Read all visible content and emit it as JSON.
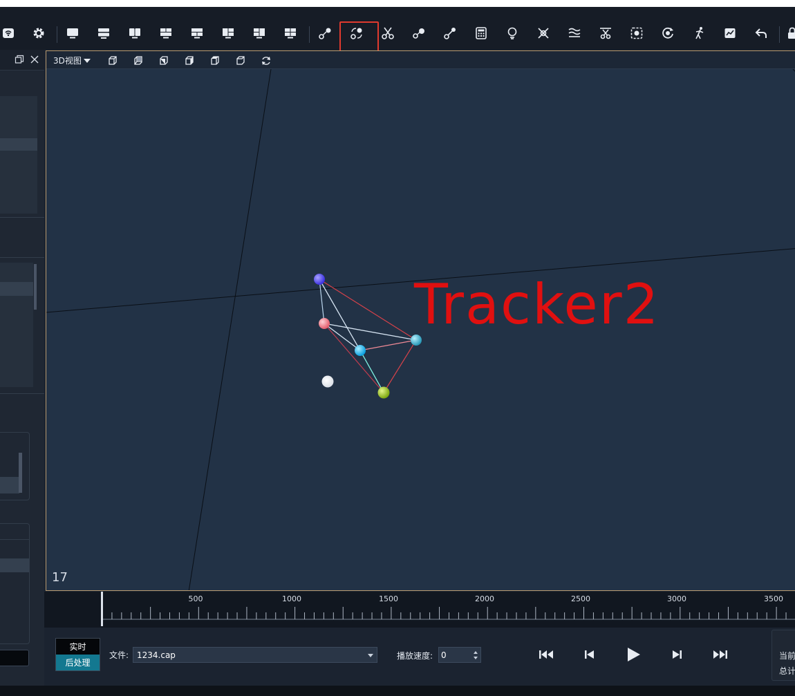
{
  "colors": {
    "accent_highlight": "#e03a2e",
    "viewport_bg": "#223246",
    "viewport_border": "#b99a6e",
    "overlay_text": "#e01010",
    "post_mode_bg": "#137890"
  },
  "toolbar": {
    "icons": [
      "wifi-settings-icon",
      "gear-icon",
      "layout-single-icon",
      "layout-split-horizontal-icon",
      "layout-split-vertical-icon",
      "layout-grid-icon",
      "layout-top-split-icon",
      "layout-right-split-icon",
      "layout-left-split-icon",
      "layout-quad-icon",
      "marker-link-icon",
      "marker-rename-icon",
      "cut-icon",
      "marker-add-icon",
      "marker-connect-icon",
      "calculator-icon",
      "bulb-icon",
      "delete-marker-icon",
      "smooth-wave-icon",
      "trim-icon",
      "target-frame-icon",
      "rotate-target-icon",
      "skeleton-icon",
      "chart-icon",
      "undo-icon",
      "lock-icon"
    ],
    "highlighted_icon": "marker-rename-icon"
  },
  "left_panel": {
    "restore_icon": "restore-window-icon",
    "close_icon": "close-icon"
  },
  "viewport": {
    "view_mode": "3D视图",
    "view_icons": [
      "view-front-icon",
      "view-back-icon",
      "view-left-icon",
      "view-right-icon",
      "view-top-icon",
      "view-bottom-icon",
      "view-reset-icon"
    ],
    "frame_number": "17",
    "overlay_label": "Tracker2",
    "markers": [
      {
        "name": "marker-blue",
        "color": "#4a3ff0"
      },
      {
        "name": "marker-pink",
        "color": "#f07a86"
      },
      {
        "name": "marker-cyan-center",
        "color": "#16b8f0"
      },
      {
        "name": "marker-teal",
        "color": "#3ab0c8"
      },
      {
        "name": "marker-green",
        "color": "#9ac020"
      },
      {
        "name": "marker-white",
        "color": "#ffffff"
      }
    ]
  },
  "timeline": {
    "ticks": [
      "500",
      "1000",
      "1500",
      "2000",
      "2500",
      "3000",
      "3500"
    ]
  },
  "playback": {
    "mode_realtime": "实时",
    "mode_post": "后处理",
    "file_label": "文件:",
    "file_value": "1234.cap",
    "speed_label": "播放速度:",
    "speed_value": "0",
    "buttons": [
      "skip-to-start-icon",
      "step-back-icon",
      "play-icon",
      "step-forward-icon",
      "skip-to-end-icon"
    ],
    "stats_line1": "当前",
    "stats_line2": "总计"
  }
}
